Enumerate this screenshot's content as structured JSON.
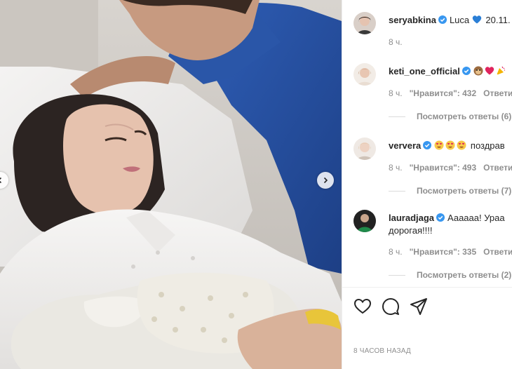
{
  "caption": {
    "username": "seryabkina",
    "text": "Luca",
    "date_suffix": "20.11.",
    "age": "8 ч."
  },
  "comments": [
    {
      "username": "keti_one_official",
      "text": "",
      "age": "8 ч.",
      "likes": "\"Нравится\": 432",
      "reply_label": "Ответить",
      "view_replies": "Посмотреть ответы (6)",
      "emojis": [
        "monkey-emoji",
        "heart-emoji",
        "party-emoji"
      ]
    },
    {
      "username": "ververa",
      "text": "поздрав",
      "age": "8 ч.",
      "likes": "\"Нравится\": 493",
      "reply_label": "Ответить",
      "view_replies": "Посмотреть ответы (7)",
      "emojis": [
        "heart-eyes-emoji",
        "heart-eyes-emoji",
        "heart-eyes-emoji"
      ]
    },
    {
      "username": "lauradjaga",
      "text": "Аааааа! Ураа",
      "text_line2": "дорогая!!!!",
      "age": "8 ч.",
      "likes": "\"Нравится\": 335",
      "reply_label": "Ответить",
      "view_replies": "Посмотреть ответы (2)"
    }
  ],
  "timestamp": "8 ЧАСОВ НАЗАД",
  "colors": {
    "verified": "#3897f0",
    "text": "#262626",
    "muted": "#8e8e8e"
  }
}
